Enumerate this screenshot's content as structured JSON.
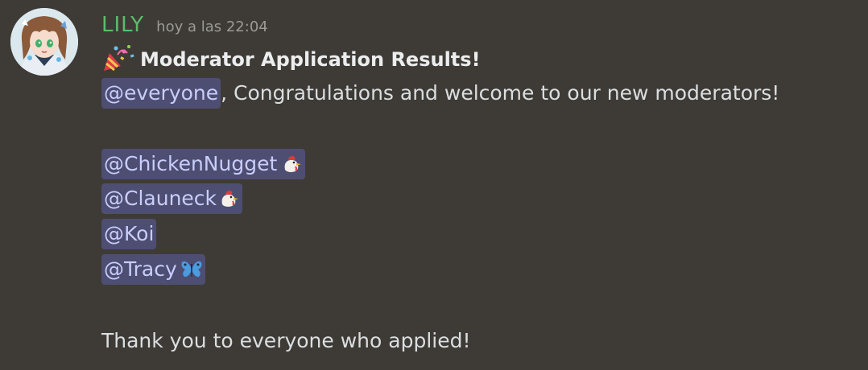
{
  "message": {
    "author": "LILY",
    "timestamp": "hoy a las 22:04",
    "author_color": "#5bbd6b",
    "avatar_icon": "anime-girl-avatar",
    "title_icon": "party-popper-icon",
    "title": "Moderator Application Results!",
    "everyone_mention": "@everyone",
    "everyone_text": ", Congratulations and welcome to our new moderators!",
    "mentions": [
      {
        "label": "@ChickenNugget",
        "emoji": "rooster-icon"
      },
      {
        "label": "@Clauneck",
        "emoji": "rooster-icon"
      },
      {
        "label": "@Koi",
        "emoji": ""
      },
      {
        "label": "@Tracy",
        "emoji": "butterfly-icon"
      }
    ],
    "closing_text": "Thank you to everyone who applied!"
  },
  "colors": {
    "background": "#3e3b36",
    "mention_bg": "#4e4e73",
    "mention_text": "#c9cdfb",
    "timestamp": "#9b9a94"
  }
}
